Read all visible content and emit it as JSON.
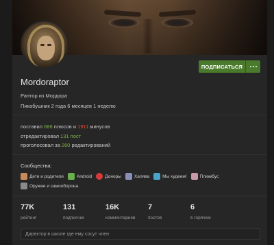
{
  "profile": {
    "username": "Mordoraptor",
    "subtitle": "Раптор из Мордора",
    "tenure": "Пикабушник 2 года 6 месяцев 1 неделю",
    "subscribe_label": "ПОДПИСАТЬСЯ"
  },
  "activity": {
    "line1_a": "поставил ",
    "pluses": "686",
    "line1_b": " плюсов и ",
    "minuses": "1911",
    "line1_c": " минусов",
    "line2_a": "отредактировал ",
    "edited_posts": "131 пост",
    "line3_a": "проголосовал за ",
    "voted": "260",
    "line3_b": " редактирований"
  },
  "communities": {
    "title": "Сообщества:",
    "items": [
      {
        "label": "Дети и родители",
        "icon": "family-icon",
        "color": "#c98a5a"
      },
      {
        "label": "Android",
        "icon": "android-icon",
        "color": "#6ab04c"
      },
      {
        "label": "Доноры",
        "icon": "heart-icon",
        "color": "#d63a3a"
      },
      {
        "label": "Халява",
        "icon": "gift-icon",
        "color": "#8a8fb8"
      },
      {
        "label": "Мы худеем!",
        "icon": "scale-icon",
        "color": "#4aa3c8"
      },
      {
        "label": "Плюмбус",
        "icon": "plumbus-icon",
        "color": "#c89aa8"
      },
      {
        "label": "Оружие и самооборона",
        "icon": "weapon-icon",
        "color": "#8a8a8a"
      }
    ]
  },
  "counts": [
    {
      "value": "77K",
      "label": "рейтинг"
    },
    {
      "value": "131",
      "label": "подписчик"
    },
    {
      "value": "16K",
      "label": "комментариев"
    },
    {
      "value": "7",
      "label": "постов"
    },
    {
      "value": "6",
      "label": "в горячем"
    }
  ],
  "note": {
    "placeholder": "Директор в школе где ему сосут член"
  },
  "colors": {
    "accent_green": "#4a7a2c",
    "plus_green": "#7bb342",
    "minus_red": "#e04a3a"
  }
}
